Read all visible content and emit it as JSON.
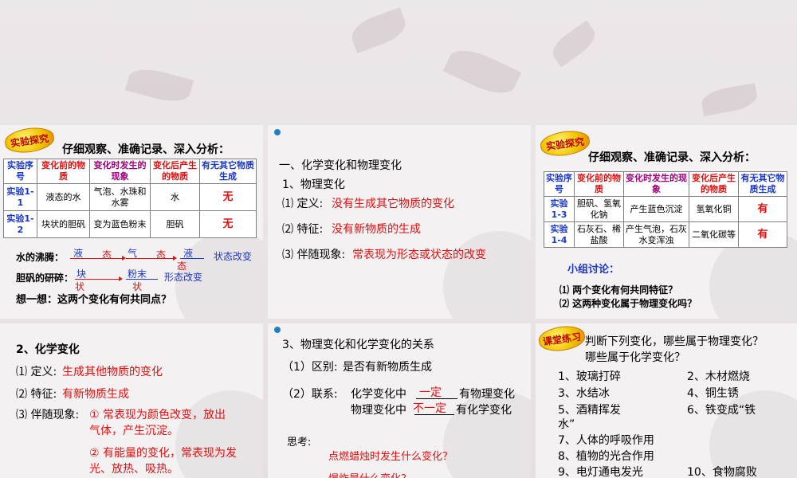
{
  "slide1": {
    "badge": "实验探究",
    "heading": "仔细观察、准确记录、深入分析：",
    "table": {
      "headers": [
        "实验序号",
        "变化前的物质",
        "变化时发生的现象",
        "变化后产生的物质",
        "有无其它物质生成"
      ],
      "rows": [
        [
          "实验1-1",
          "液态的水",
          "气泡、水珠和水雾",
          "水",
          "无"
        ],
        [
          "实验1-2",
          "块状的胆矾",
          "变为蓝色粉末",
          "胆矾",
          "无"
        ]
      ]
    },
    "boil_label": "水的沸腾：",
    "boil_steps": [
      "液",
      "态",
      "气",
      "态",
      "液",
      "态"
    ],
    "boil_result": "状态改变",
    "grind_label": "胆矾的研碎：",
    "grind_steps": [
      "块",
      "状",
      "粉末",
      "状"
    ],
    "grind_result": "形态改变",
    "question": "想一想：这两个变化有何共同点？"
  },
  "slide2": {
    "title": "一、化学变化和物理变化",
    "sub": "1、物理变化",
    "def_label": "⑴ 定义:",
    "def_value": "没有生成其它物质的变化",
    "feat_label": "⑵ 特征:",
    "feat_value": "没有新物质的生成",
    "phen_label": "⑶ 伴随现象:",
    "phen_value": "常表现为形态或状态的改变"
  },
  "slide3": {
    "badge": "实验探究",
    "heading": "仔细观察、准确记录、深入分析：",
    "table": {
      "headers": [
        "实验序号",
        "变化前的物质",
        "变化时发生的现象",
        "变化后产生的物质",
        "有无其它物质生成"
      ],
      "rows": [
        [
          "实验1-3",
          "胆矾、氢氧化钠",
          "产生蓝色沉淀",
          "氢氧化铜",
          "有"
        ],
        [
          "实验1-4",
          "石灰石、稀盐酸",
          "产生气泡，石灰水变浑浊",
          "二氧化碳等",
          "有"
        ]
      ]
    },
    "discussion_title": "小组讨论：",
    "q1": "⑴ 两个变化有何共同特征？",
    "q2": "⑵ 这两种变化属于物理变化吗？"
  },
  "slide4": {
    "sub": "2、化学变化",
    "def_label": "⑴ 定义:",
    "def_value": "生成其他物质的变化",
    "feat_label": "⑵ 特征:",
    "feat_value": "有新物质生成",
    "phen_label": "⑶ 伴随现象:",
    "phen_1a": "① 常表现为颜色改变，放出",
    "phen_1b": "气体，产生沉淀。",
    "phen_2a": "② 有能量的变化，常表现为发",
    "phen_2b": "光、放热、吸热。"
  },
  "slide5": {
    "title": "3、物理变化和化学变化的关系",
    "diff_label": "（1）区别:",
    "diff_value": "是否有新物质生成",
    "link_label": "（2）联系:",
    "link_1_pre": "化学变化中",
    "link_1_blank": "一定",
    "link_1_post": "有物理变化",
    "link_2_pre": "物理变化中",
    "link_2_blank": "不一定",
    "link_2_post": "有化学变化",
    "think_label": "思考:",
    "think_q1": "点燃蜡烛时发生什么变化？",
    "think_q2": "爆炸是什么变化？"
  },
  "slide6": {
    "badge": "课堂练习",
    "prompt_1": "判断下列变化，哪些属于物理变化？",
    "prompt_2": "哪些属于化学变化？",
    "items": [
      "1、玻璃打碎",
      "2、木材燃烧",
      "3、水结冰",
      "4、铜生锈",
      "5、酒精挥发",
      "6、铁变成“铁",
      "水”",
      "",
      "7、人体的呼吸作用",
      "",
      "8、植物的光合作用",
      "",
      "9、电灯通电发光",
      "10、食物腐败"
    ]
  }
}
